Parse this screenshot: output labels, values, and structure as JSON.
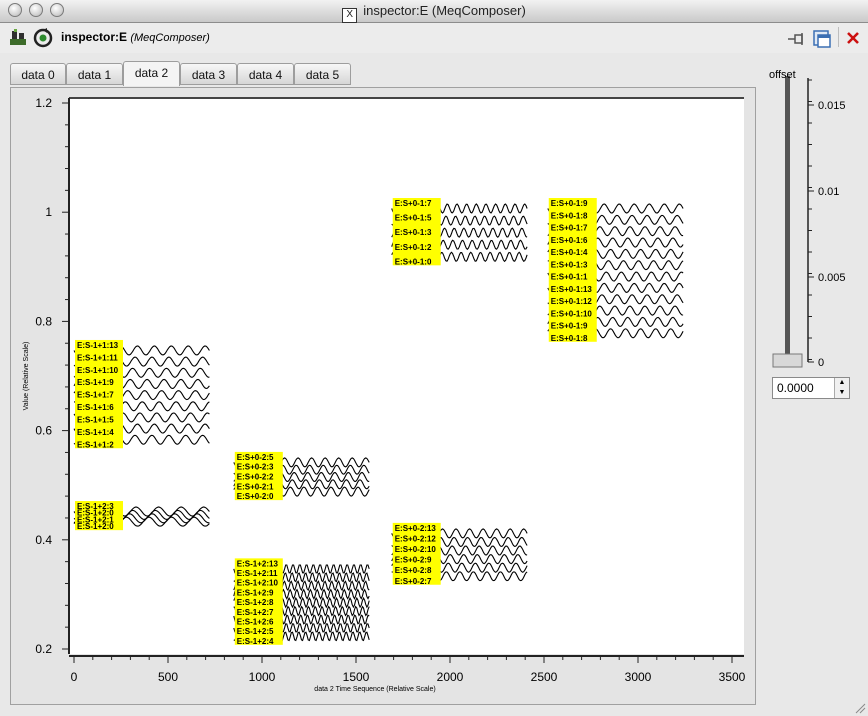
{
  "window": {
    "title": "inspector:E (MeqComposer)"
  },
  "toolbar": {
    "inspector_name": "inspector:E",
    "inspector_app": "(MeqComposer)",
    "icons": [
      "network-icon",
      "refresh-icon",
      "pin-icon",
      "float-window-icon",
      "close-icon"
    ]
  },
  "tabs": [
    {
      "label": "data 0",
      "active": false
    },
    {
      "label": "data 1",
      "active": false
    },
    {
      "label": "data 2",
      "active": true
    },
    {
      "label": "data 3",
      "active": false
    },
    {
      "label": "data 4",
      "active": false
    },
    {
      "label": "data 5",
      "active": false
    }
  ],
  "offset": {
    "label": "offset",
    "value": "0.0000",
    "scale_ticks": [
      "0.015",
      "0.01",
      "0.005",
      "0"
    ]
  },
  "chart_data": {
    "type": "line",
    "xlabel": "data 2 Time Sequence (Relative Scale)",
    "ylabel": "Value (Relative Scale)",
    "xlim": [
      0,
      3500
    ],
    "ylim": [
      0.2,
      1.2
    ],
    "xticks": [
      "0",
      "500",
      "1000",
      "1500",
      "2000",
      "2500",
      "3000",
      "3500"
    ],
    "yticks": [
      "0.2",
      "0.4",
      "0.6",
      "0.8",
      "1",
      "1.2"
    ],
    "groups": [
      {
        "x_start": 0,
        "x_end": 720,
        "y_top": 0.755,
        "y_bottom": 0.575,
        "labels": [
          "E:S-1+1:13",
          "E:S-1+1:11",
          "E:S-1+1:10",
          "E:S-1+1:9",
          "E:S-1+1:7",
          "E:S-1+1:6",
          "E:S-1+1:5",
          "E:S-1+1:4",
          "E:S-1+1:2"
        ],
        "wave_cycles": 8
      },
      {
        "x_start": 0,
        "x_end": 720,
        "y_top": 0.46,
        "y_bottom": 0.425,
        "labels": [
          "E:S-1+2:3",
          "E:S-1+2:0",
          "E:S-1+2:1",
          "E:S-1+2:0"
        ],
        "wave_cycles": 6
      },
      {
        "x_start": 850,
        "x_end": 1570,
        "y_top": 0.55,
        "y_bottom": 0.48,
        "labels": [
          "E:S+0-2:5",
          "E:S+0-2:3",
          "E:S+0-2:2",
          "E:S+0-2:1",
          "E:S+0-2:0"
        ],
        "wave_cycles": 10
      },
      {
        "x_start": 850,
        "x_end": 1570,
        "y_top": 0.355,
        "y_bottom": 0.215,
        "labels": [
          "E:S-1+2:13",
          "E:S-1+2:11",
          "E:S-1+2:10",
          "E:S-1+2:9",
          "E:S-1+2:8",
          "E:S-1+2:7",
          "E:S-1+2:6",
          "E:S-1+2:5",
          "E:S-1+2:4"
        ],
        "wave_cycles": 20
      },
      {
        "x_start": 1690,
        "x_end": 2410,
        "y_top": 1.015,
        "y_bottom": 0.91,
        "labels": [
          "E:S+0-1:7",
          "E:S+0-1:5",
          "E:S+0-1:3",
          "E:S+0-1:2",
          "E:S+0-1:0"
        ],
        "wave_cycles": 14
      },
      {
        "x_start": 1690,
        "x_end": 2410,
        "y_top": 0.42,
        "y_bottom": 0.325,
        "labels": [
          "E:S+0-2:13",
          "E:S+0-2:12",
          "E:S+0-2:10",
          "E:S+0-2:9",
          "E:S+0-2:8",
          "E:S+0-2:7"
        ],
        "wave_cycles": 10
      },
      {
        "x_start": 2520,
        "x_end": 3240,
        "y_top": 1.015,
        "y_bottom": 0.77,
        "labels": [
          "E:S+0-1:9",
          "E:S+0-1:8",
          "E:S+0-1:7",
          "E:S+0-1:6",
          "E:S+0-1:4",
          "E:S+0-1:3",
          "E:S+0-1:1",
          "E:S+0-1:13",
          "E:S+0-1:12",
          "E:S+0-1:10",
          "E:S+0-1:9",
          "E:S+0-1:8"
        ],
        "wave_cycles": 9
      }
    ]
  }
}
